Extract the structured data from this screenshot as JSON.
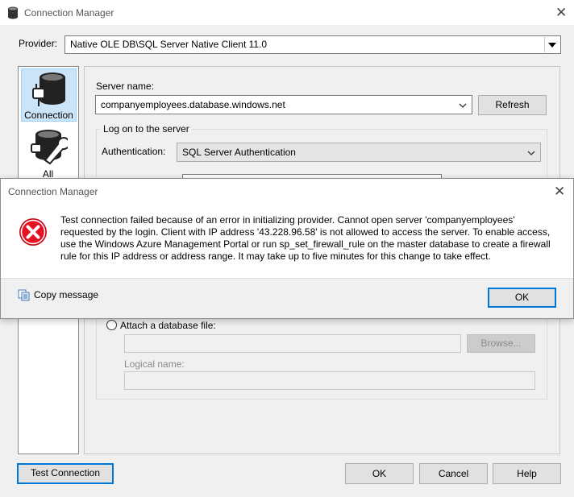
{
  "main_window": {
    "title": "Connection Manager",
    "provider_label": "Provider:",
    "provider_value": "Native OLE DB\\SQL Server Native Client 11.0",
    "sidebar": [
      {
        "label": "Connection",
        "icon": "database-plug-icon"
      },
      {
        "label": "All",
        "icon": "database-wrench-icon"
      }
    ],
    "server_name_label": "Server name:",
    "server_name_value": "companyemployees.database.windows.net",
    "refresh_label": "Refresh",
    "logon_group_label": "Log on to the server",
    "authentication_label": "Authentication:",
    "authentication_value": "SQL Server Authentication",
    "attach_label": "Attach a database file:",
    "browse_label": "Browse...",
    "logical_name_label": "Logical name:",
    "test_connection_label": "Test Connection",
    "ok_label": "OK",
    "cancel_label": "Cancel",
    "help_label": "Help"
  },
  "error_dialog": {
    "title": "Connection Manager",
    "icon": "error-icon",
    "message_lines": [
      "Test connection failed because of an error in initializing provider. Cannot open server 'companyemployees'",
      "requested by the login. Client with IP address '43.228.96.58' is not allowed to access the server.  To enable access,",
      "use the Windows Azure Management Portal or run sp_set_firewall_rule on the master database to create a firewall",
      "rule for this IP address or address range.  It may take up to five minutes for this change to take effect."
    ],
    "copy_message_label": "Copy message",
    "ok_label": "OK"
  },
  "colors": {
    "accent": "#0078d7",
    "error": "#e81123",
    "selected_tab": "#cce4f7"
  }
}
